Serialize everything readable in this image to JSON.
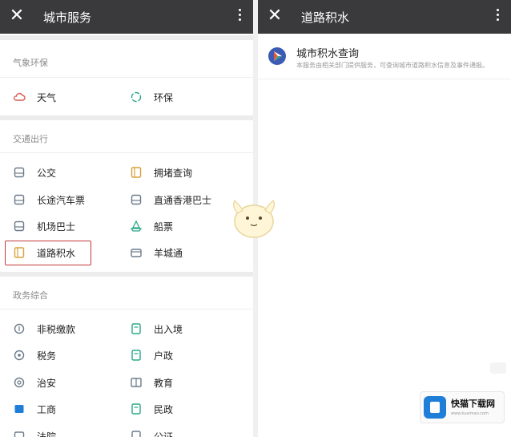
{
  "left": {
    "title": "城市服务",
    "sections": {
      "weather": {
        "title": "气象环保",
        "items": [
          "天气",
          "环保"
        ]
      },
      "traffic": {
        "title": "交通出行",
        "items": [
          "公交",
          "拥堵查询",
          "长途汽车票",
          "直通香港巴士",
          "机场巴士",
          "船票",
          "道路积水",
          "羊城通"
        ]
      },
      "gov": {
        "title": "政务综合",
        "items": [
          "非税缴款",
          "出入境",
          "税务",
          "户政",
          "治安",
          "教育",
          "工商",
          "民政",
          "法院",
          "公证"
        ]
      }
    }
  },
  "right": {
    "title": "道路积水",
    "app": {
      "title": "城市积水查询",
      "desc": "本服务由相关部门提供服务，可查询城市道路积水信息及事件通报。"
    }
  },
  "watermark": {
    "name": "快猫下载网",
    "url": "www.kuaimao.com"
  },
  "colors": {
    "titlebar": "#3a3a3c",
    "icon_gray": "#6b7b8a",
    "icon_green": "#2aa889",
    "icon_gold": "#d8a23a",
    "icon_red": "#d95a4e",
    "highlight": "#c43a3a"
  }
}
